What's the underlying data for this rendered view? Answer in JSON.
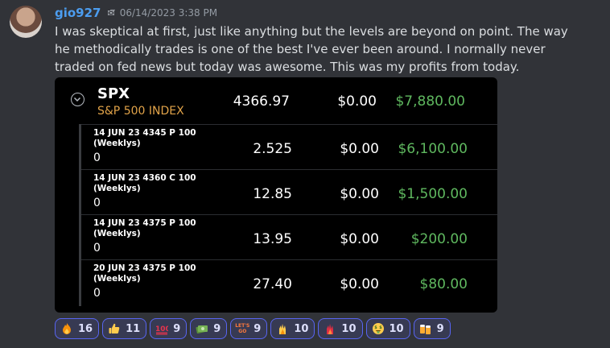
{
  "post": {
    "username": "gio927",
    "badge": "✉̅",
    "timestamp": "06/14/2023 3:38 PM",
    "message": "I was skeptical at first, just like anything but the levels are beyond on point. The way he methodically trades is one of the best I've ever been around. I normally never traded on fed news but today was awesome. This was my profits from today."
  },
  "position": {
    "symbol": "SPX",
    "name": "S&P 500 INDEX",
    "price": "4366.97",
    "cost": "$0.00",
    "profit": "$7,880.00",
    "profit_color": "#5fb85f",
    "name_color": "#e1a349",
    "rows": [
      {
        "title": "14 JUN 23 4345 P 100 (Weeklys)",
        "qty": "0",
        "price": "2.525",
        "cost": "$0.00",
        "profit": "$6,100.00"
      },
      {
        "title": "14 JUN 23 4360 C 100 (Weeklys)",
        "qty": "0",
        "price": "12.85",
        "cost": "$0.00",
        "profit": "$1,500.00"
      },
      {
        "title": "14 JUN 23 4375 P 100 (Weeklys)",
        "qty": "0",
        "price": "13.95",
        "cost": "$0.00",
        "profit": "$200.00"
      },
      {
        "title": "20 JUN 23 4375 P 100 (Weeklys)",
        "qty": "0",
        "price": "27.40",
        "cost": "$0.00",
        "profit": "$80.00"
      }
    ]
  },
  "reactions": [
    {
      "icon": "fire-emoji",
      "count": "16"
    },
    {
      "icon": "thumbs-up-emoji",
      "count": "11"
    },
    {
      "icon": "hundred-emoji",
      "count": "9"
    },
    {
      "icon": "money-emoji",
      "count": "9"
    },
    {
      "icon": "lets-go-emoji",
      "label": "LET'S GO",
      "count": "9"
    },
    {
      "icon": "fire-hand-emoji",
      "count": "10"
    },
    {
      "icon": "red-fire-hand-emoji",
      "count": "10"
    },
    {
      "icon": "money-face-emoji",
      "count": "10"
    },
    {
      "icon": "beer-emoji",
      "count": "9"
    }
  ]
}
